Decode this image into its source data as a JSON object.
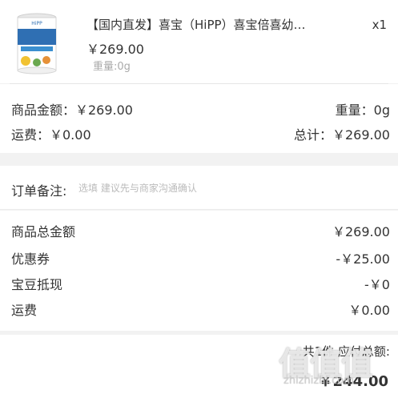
{
  "product": {
    "title": "【国内直发】喜宝（HiPP）喜宝倍喜幼…",
    "quantity": "x1",
    "price": "￥269.00",
    "weight": "重量:0g",
    "image_icon": "milk-powder-can-icon",
    "image_text": "喜宝 幼儿配方奶粉 12-36月 3段"
  },
  "summary": {
    "goods_amount": "商品金额：￥269.00",
    "weight": "重量：0g",
    "shipping": "运费：￥0.00",
    "total": "总计：￥269.00"
  },
  "remark": {
    "label": "订单备注:",
    "placeholder": "选填 建议先与商家沟通确认"
  },
  "costs": [
    {
      "label": "商品总金额",
      "value": "￥269.00"
    },
    {
      "label": "优惠券",
      "value": "-￥25.00"
    },
    {
      "label": "宝豆抵现",
      "value": "-￥0"
    },
    {
      "label": "运费",
      "value": "￥0.00"
    }
  ],
  "footer": {
    "count_text": "共1件 应付总额:",
    "total": "￥244.00"
  },
  "watermark": {
    "logo": "值值值",
    "domain": "zhizhizhi.com"
  },
  "colors": {
    "background": "#f2f2f2",
    "card": "#ffffff",
    "text": "#333333",
    "muted": "#aaaaaa",
    "can_blue": "#2f6fb3"
  }
}
